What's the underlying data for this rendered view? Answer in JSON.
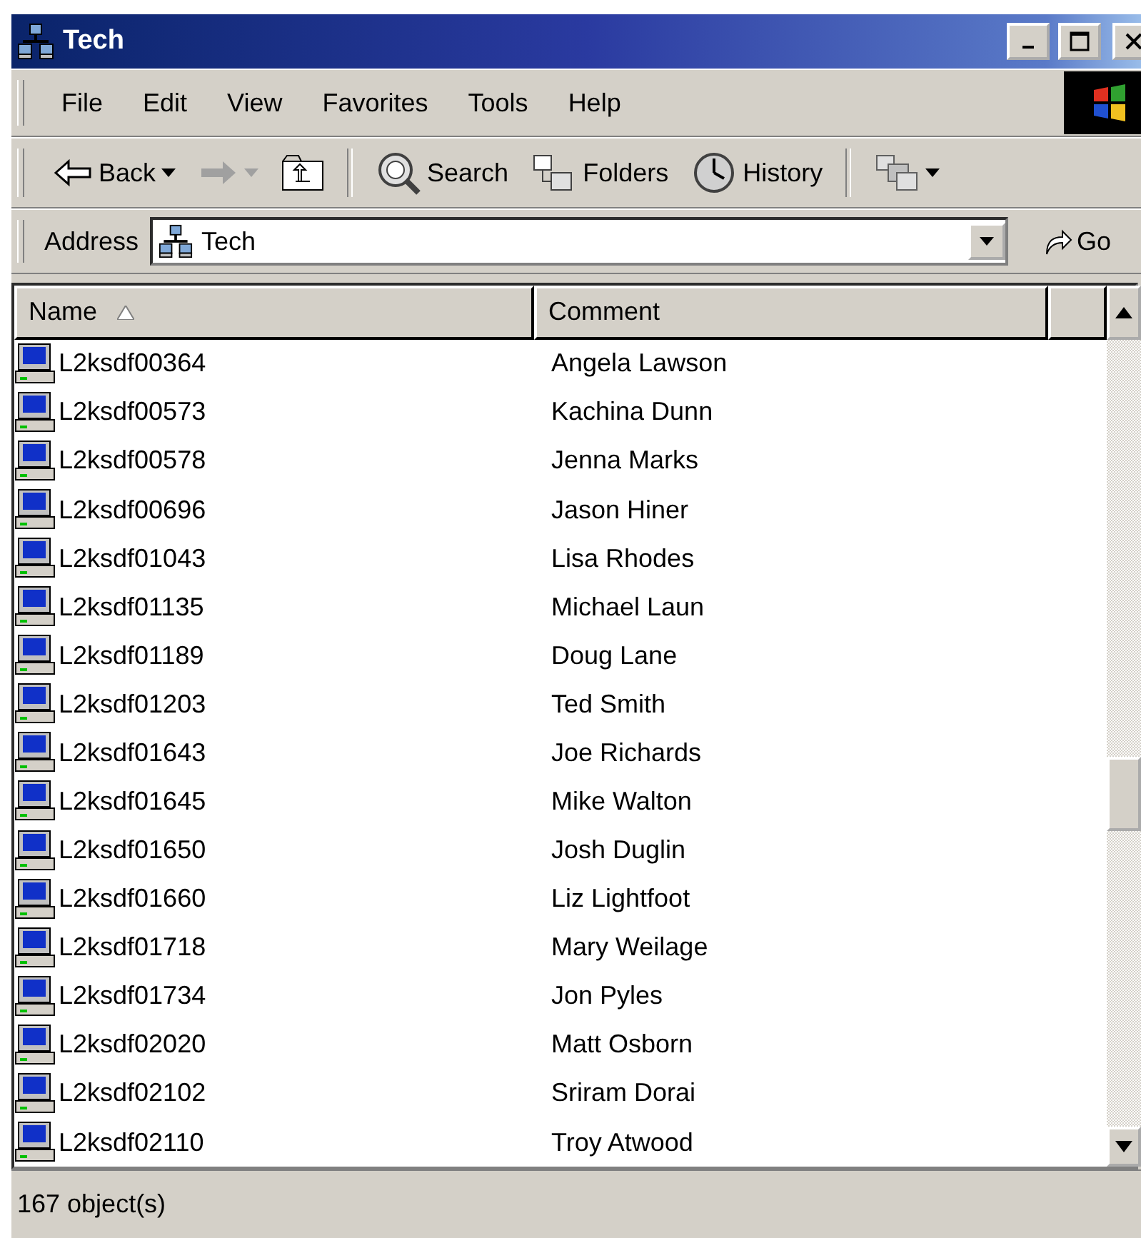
{
  "window": {
    "title": "Tech"
  },
  "menu": [
    {
      "label": "File"
    },
    {
      "label": "Edit"
    },
    {
      "label": "View"
    },
    {
      "label": "Favorites"
    },
    {
      "label": "Tools"
    },
    {
      "label": "Help"
    }
  ],
  "toolbar": [
    {
      "kind": "back",
      "label": "Back",
      "disabled": false,
      "dropdown": true
    },
    {
      "kind": "forward",
      "disabled": true,
      "dropdown": true
    },
    {
      "kind": "up",
      "disabled": false,
      "dropdown": false
    },
    {
      "kind": "separator"
    },
    {
      "kind": "search",
      "label": "Search",
      "disabled": false,
      "dropdown": false
    },
    {
      "kind": "folders",
      "label": "Folders",
      "disabled": false,
      "dropdown": false
    },
    {
      "kind": "history",
      "label": "History",
      "disabled": false,
      "dropdown": false
    },
    {
      "kind": "separator"
    },
    {
      "kind": "views",
      "disabled": false,
      "dropdown": true
    }
  ],
  "address": {
    "label": "Address",
    "value": "Tech",
    "go": "Go"
  },
  "table": {
    "columns": [
      {
        "label": "Name",
        "sorted": true
      },
      {
        "label": "Comment",
        "sorted": false
      },
      {
        "sorted": false
      }
    ],
    "rows": [
      {
        "name": "L2ksdf00364",
        "comment": "Angela Lawson"
      },
      {
        "name": "L2ksdf00573",
        "comment": "Kachina Dunn"
      },
      {
        "name": "L2ksdf00578",
        "comment": "Jenna Marks"
      },
      {
        "name": "L2ksdf00696",
        "comment": "Jason Hiner"
      },
      {
        "name": "L2ksdf01043",
        "comment": "Lisa Rhodes"
      },
      {
        "name": "L2ksdf01135",
        "comment": "Michael Laun"
      },
      {
        "name": "L2ksdf01189",
        "comment": "Doug Lane"
      },
      {
        "name": "L2ksdf01203",
        "comment": "Ted Smith"
      },
      {
        "name": "L2ksdf01643",
        "comment": "Joe Richards"
      },
      {
        "name": "L2ksdf01645",
        "comment": "Mike Walton"
      },
      {
        "name": "L2ksdf01650",
        "comment": "Josh Duglin"
      },
      {
        "name": "L2ksdf01660",
        "comment": "Liz Lightfoot"
      },
      {
        "name": "L2ksdf01718",
        "comment": "Mary Weilage"
      },
      {
        "name": "L2ksdf01734",
        "comment": "Jon Pyles"
      },
      {
        "name": "L2ksdf02020",
        "comment": "Matt Osborn"
      },
      {
        "name": "L2ksdf02102",
        "comment": "Sriram Dorai"
      },
      {
        "name": "L2ksdf02110",
        "comment": "Troy Atwood"
      }
    ]
  },
  "status_bar": {
    "text": "167 object(s)"
  }
}
